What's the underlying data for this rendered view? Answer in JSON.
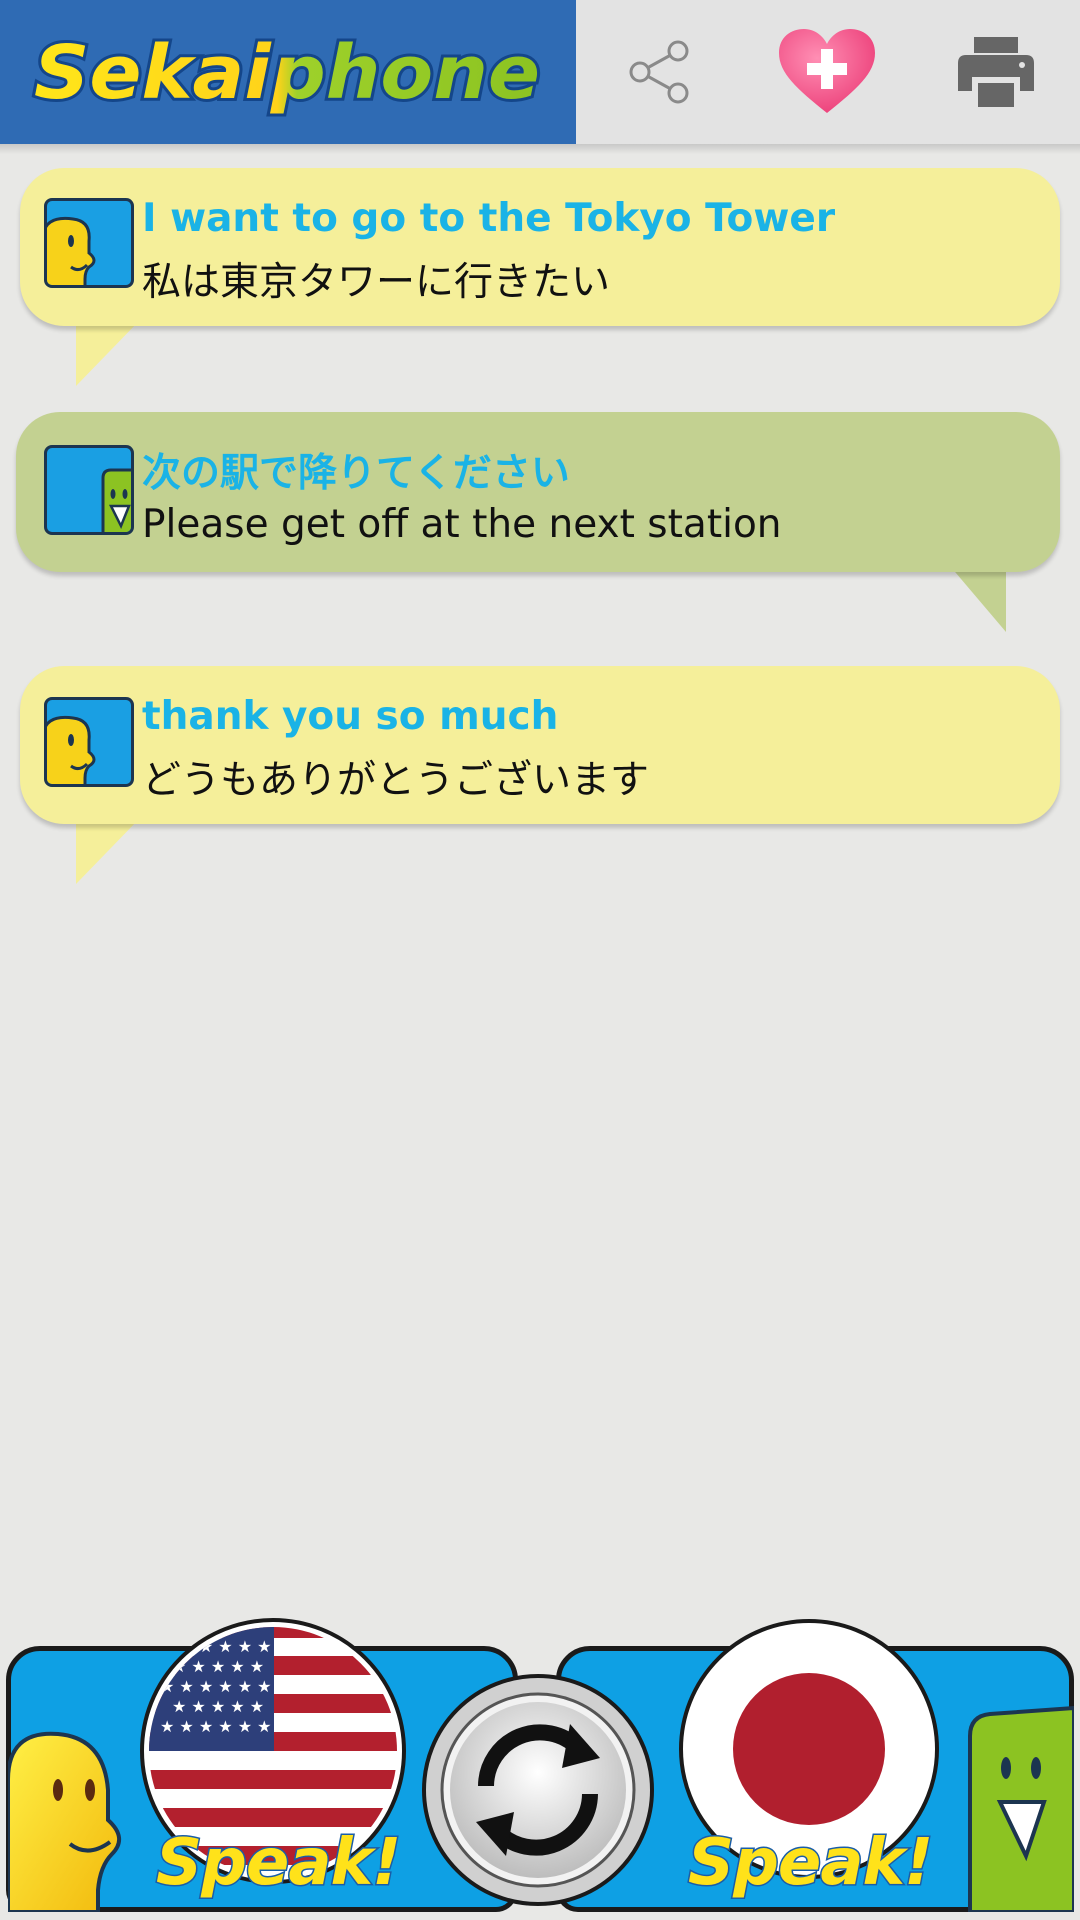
{
  "app": {
    "logo_text": "Sekaiphone"
  },
  "toolbar": {
    "share_icon": "share-icon",
    "favorite_icon": "heart-plus-icon",
    "print_icon": "printer-icon"
  },
  "conversation": [
    {
      "speaker": "english",
      "main_text": "I want to go to the Tokyo Tower",
      "sub_text": "私は東京タワーに行きたい",
      "bubble_color": "#f5ef9a"
    },
    {
      "speaker": "japanese",
      "main_text": "次の駅で降りてください",
      "sub_text": "Please get off at the next station",
      "bubble_color": "#c3d191"
    },
    {
      "speaker": "english",
      "main_text": "thank you so much",
      "sub_text": "どうもありがとうございます",
      "bubble_color": "#f5ef9a"
    }
  ],
  "controls": {
    "left_speak_label": "Speak!",
    "right_speak_label": "Speak!",
    "left_language_flag": "us-flag",
    "right_language_flag": "japan-flag",
    "swap_icon": "swap-arrows-icon"
  },
  "colors": {
    "header_blue": "#2f6bb4",
    "accent_text": "#1ab3e6",
    "panel_blue": "#0ea0e4",
    "speak_yellow": "#ffe21a"
  }
}
